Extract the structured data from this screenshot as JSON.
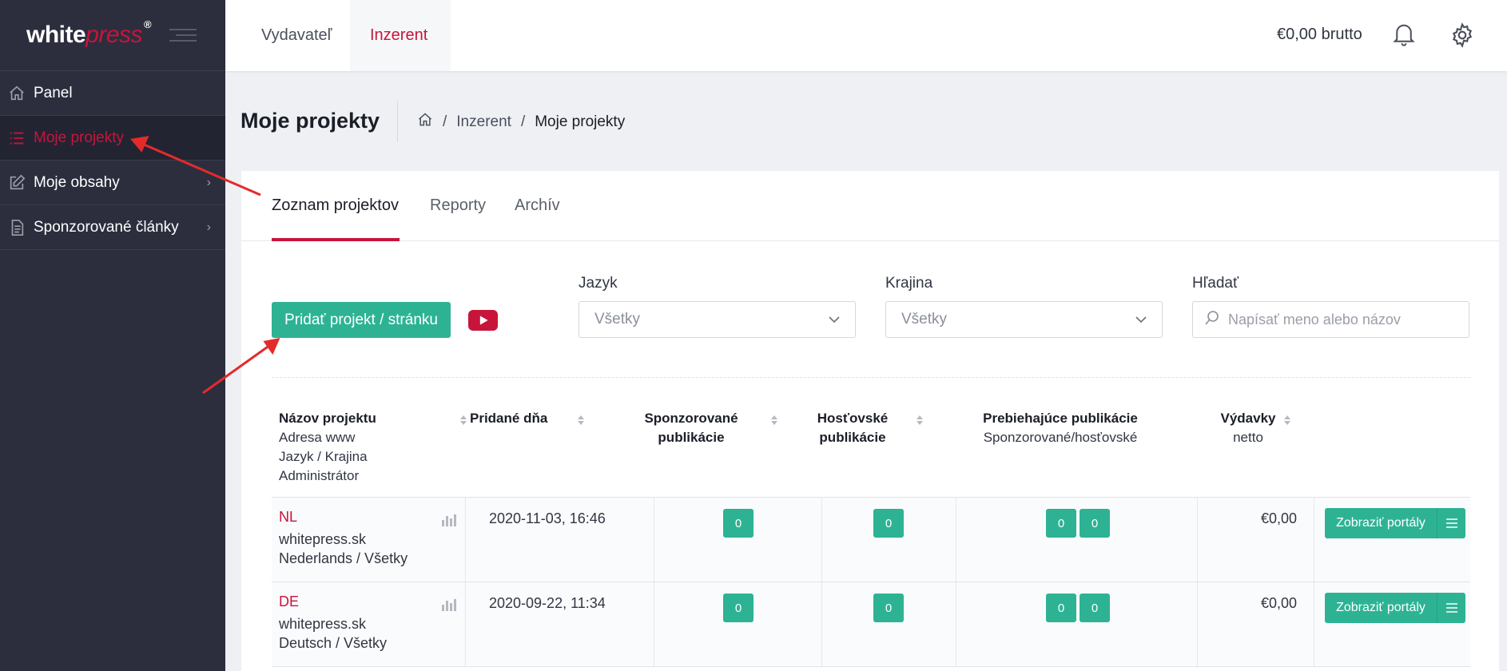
{
  "logo": {
    "white": "white",
    "press": "press",
    "reg": "®"
  },
  "sidebar": {
    "items": [
      {
        "label": "Panel",
        "icon": "home-icon"
      },
      {
        "label": "Moje projekty",
        "icon": "list-icon"
      },
      {
        "label": "Moje obsahy",
        "icon": "edit-icon"
      },
      {
        "label": "Sponzorované články",
        "icon": "document-icon"
      }
    ]
  },
  "topbar": {
    "tabs": [
      "Vydavateľ",
      "Inzerent"
    ],
    "balance": "€0,00 brutto"
  },
  "page": {
    "title": "Moje projekty",
    "breadcrumb": [
      "Inzerent",
      "Moje projekty"
    ]
  },
  "tabs": [
    "Zoznam projektov",
    "Reporty",
    "Archív"
  ],
  "toolbar": {
    "add_label": "Pridať projekt / stránku"
  },
  "filters": {
    "language": {
      "label": "Jazyk",
      "value": "Všetky"
    },
    "country": {
      "label": "Krajina",
      "value": "Všetky"
    },
    "search": {
      "label": "Hľadať",
      "placeholder": "Napísať meno alebo názov"
    }
  },
  "table": {
    "headers": {
      "name": {
        "title": "Názov projektu",
        "sub": [
          "Adresa www",
          "Jazyk / Krajina",
          "Administrátor"
        ]
      },
      "added": {
        "title": "Pridané dňa"
      },
      "sponsored": {
        "title": [
          "Sponzorované",
          "publikácie"
        ]
      },
      "guest": {
        "title": [
          "Hosťovské",
          "publikácie"
        ]
      },
      "ongoing": {
        "title": "Prebiehajúce publikácie",
        "sub": "Sponzorované/hosťovské"
      },
      "spend": {
        "title": "Výdavky",
        "sub": "netto"
      }
    },
    "rows": [
      {
        "code": "NL",
        "site": "whitepress.sk",
        "lang": "Nederlands / Všetky",
        "added": "2020-11-03, 16:46",
        "sponsored": "0",
        "guest": "0",
        "ongoing_s": "0",
        "ongoing_g": "0",
        "spend": "€0,00",
        "action": "Zobraziť portály"
      },
      {
        "code": "DE",
        "site": "whitepress.sk",
        "lang": "Deutsch / Všetky",
        "added": "2020-09-22, 11:34",
        "sponsored": "0",
        "guest": "0",
        "ongoing_s": "0",
        "ongoing_g": "0",
        "spend": "€0,00",
        "action": "Zobraziť portály"
      }
    ]
  },
  "colors": {
    "brand": "#c8143b",
    "accent": "#2db394",
    "sidebar": "#2c2e3e"
  }
}
